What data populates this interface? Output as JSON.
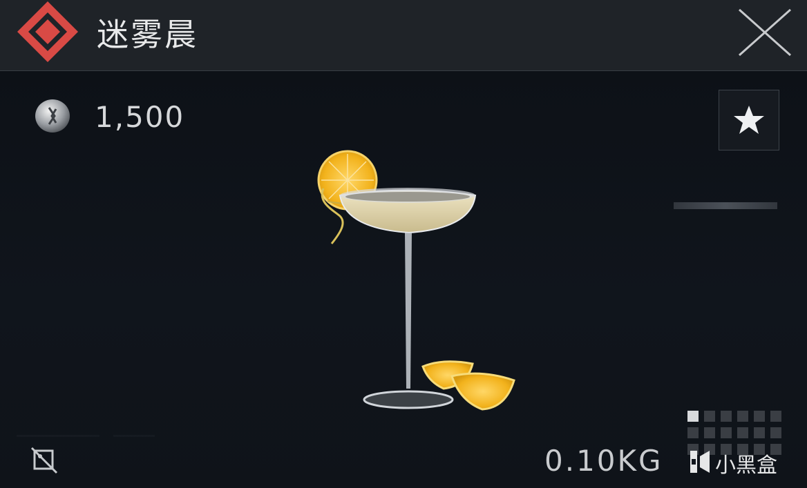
{
  "item": {
    "name": "迷雾晨",
    "price": "1,500",
    "weight": "0.10KG"
  },
  "colors": {
    "rarity_accent": "#d94a45",
    "header_bg": "#1f2328",
    "body_bg": "#10141a"
  },
  "icons": {
    "rarity": "diamond-rarity-icon",
    "close": "close-icon",
    "currency": "coin-icon",
    "favorite": "star-icon",
    "no-drop": "no-drop-icon",
    "watermark": "xiaoheihe-logo-icon"
  },
  "size_grid": {
    "columns": 6,
    "rows": 3,
    "occupied": 1
  },
  "watermark": {
    "text": "小黑盒"
  }
}
